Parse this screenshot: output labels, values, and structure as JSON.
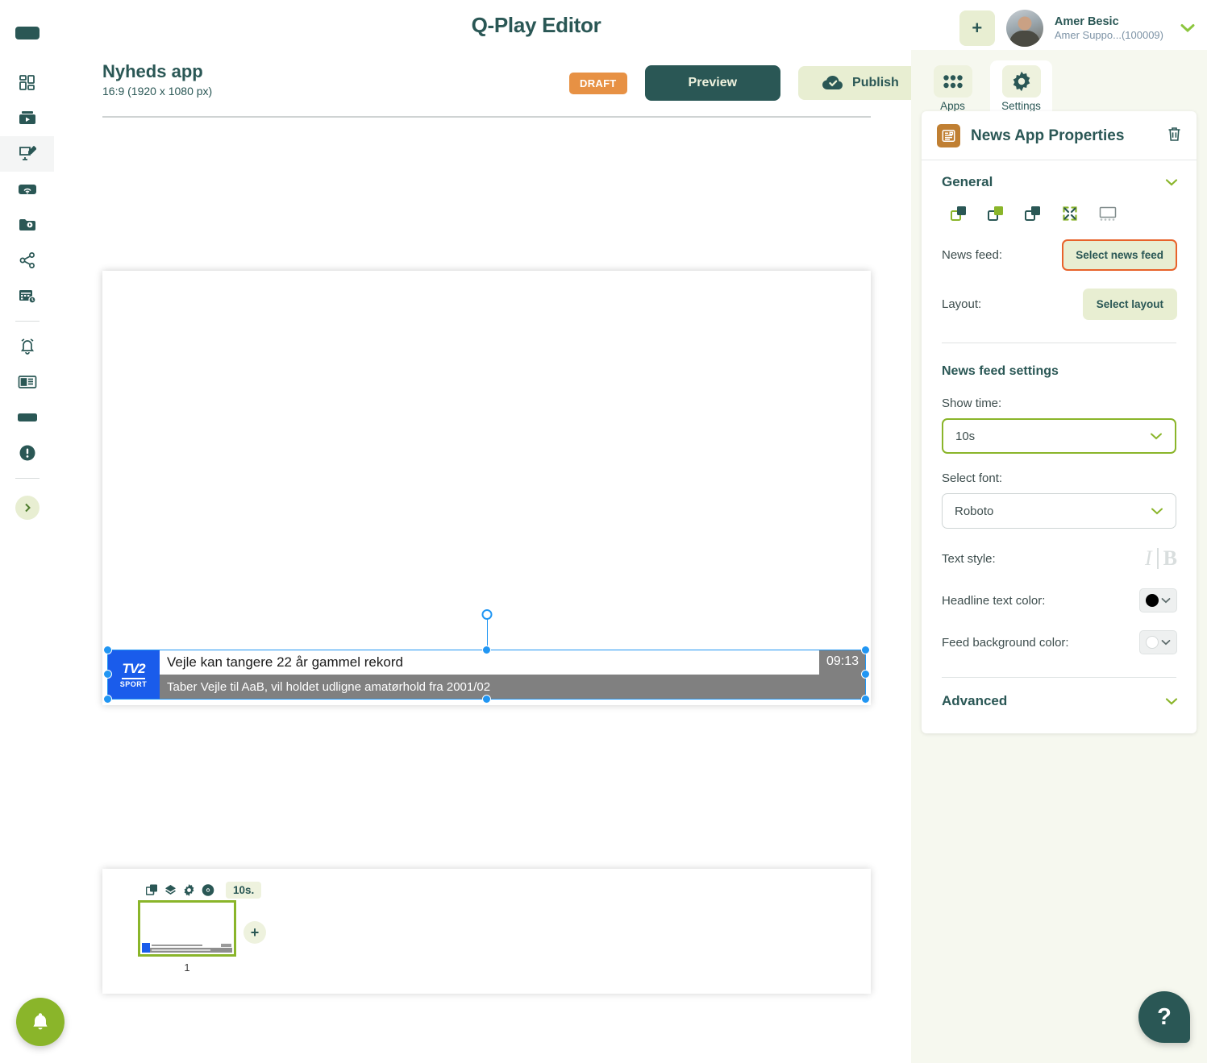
{
  "app": {
    "title": "Q-Play Editor"
  },
  "user": {
    "name": "Amer Besic",
    "org": "Amer Suppo...(100009)",
    "add_label": "+",
    "caret": "chevron-down"
  },
  "sidebar": {
    "items": [
      {
        "name": "dashboard",
        "label": "Dashboard"
      },
      {
        "name": "media",
        "label": "Media"
      },
      {
        "name": "editor",
        "label": "Editor",
        "active": true
      },
      {
        "name": "broadcast",
        "label": "Broadcast"
      },
      {
        "name": "player",
        "label": "Player"
      },
      {
        "name": "share",
        "label": "Share"
      },
      {
        "name": "schedule",
        "label": "Schedule"
      },
      {
        "name": "alerts",
        "label": "Alerts"
      },
      {
        "name": "news",
        "label": "News"
      },
      {
        "name": "screens",
        "label": "Screens"
      },
      {
        "name": "status",
        "label": "Status"
      }
    ],
    "expand_label": "Expand menu"
  },
  "document": {
    "title": "Nyheds app",
    "format": "16:9 (1920 x 1080 px)",
    "status_badge": "DRAFT",
    "preview_label": "Preview",
    "publish_label": "Publish"
  },
  "canvas": {
    "ticker": {
      "logo_main": "TV2",
      "logo_sub": "SPORT",
      "headline": "Vejle kan tangere 22 år gammel rekord",
      "subline": "Taber Vejle til AaB, vil holdet udligne amatørhold fra 2001/02",
      "time": "09:13"
    }
  },
  "slides": {
    "duration_label": "10s.",
    "slide_number": "1",
    "add_label": "+",
    "tools": [
      "duplicate-icon",
      "layers-icon",
      "settings-icon",
      "preview-icon"
    ]
  },
  "right_panel": {
    "tabs": [
      {
        "label": "Apps",
        "icon": "grid-icon",
        "active": false
      },
      {
        "label": "Settings",
        "icon": "gear-icon",
        "active": true
      }
    ],
    "properties_title": "News App Properties",
    "general": {
      "label": "General",
      "icons": [
        "bring-forward-icon",
        "bring-to-front-icon",
        "send-backward-icon",
        "fit-screen-icon",
        "snap-guides-icon"
      ]
    },
    "news_feed": {
      "label": "News feed:",
      "button": "Select news feed"
    },
    "layout": {
      "label": "Layout:",
      "button": "Select layout"
    },
    "news_feed_settings": {
      "title": "News feed settings",
      "show_time_label": "Show time:",
      "show_time_value": "10s",
      "select_font_label": "Select font:",
      "select_font_value": "Roboto",
      "text_style_label": "Text style:",
      "text_style_italic": "I",
      "text_style_bold": "B",
      "headline_color_label": "Headline text color:",
      "headline_color_value": "#000000",
      "feed_bg_label": "Feed background color:",
      "feed_bg_value": "#ffffff"
    },
    "advanced": {
      "label": "Advanced"
    }
  },
  "floating": {
    "bell_label": "Notifications",
    "help_label": "?"
  },
  "colors": {
    "brand_dark": "#2a5755",
    "brand_green": "#8ab52a",
    "accent_orange": "#e8622a",
    "draft_orange": "#e79144",
    "chip_bg": "#e8eed2"
  }
}
